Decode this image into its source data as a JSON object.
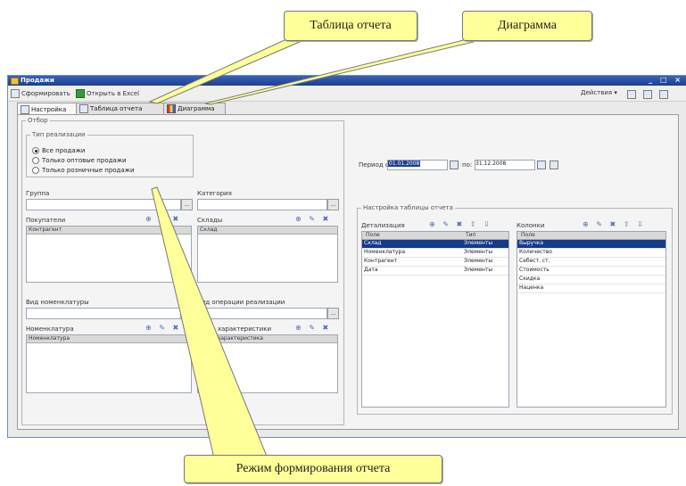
{
  "callouts": {
    "table": "Таблица отчета",
    "chart": "Диаграмма",
    "mode": "Режим формирования отчета"
  },
  "window": {
    "title": "Продажи",
    "controls": "_ □ ×"
  },
  "toolbar": {
    "generate": "Сформировать",
    "excel": "Открыть в Excel",
    "actions": "Действия ▾"
  },
  "tabs": [
    {
      "label": "Настройка"
    },
    {
      "label": "Таблица отчета"
    },
    {
      "label": "Диаграмма"
    }
  ],
  "filters": {
    "legend": "Отбор",
    "sales_type": {
      "legend": "Тип реализации",
      "options": [
        "Все продажи",
        "Только оптовые продажи",
        "Только розничные продажи"
      ]
    },
    "group_label": "Группа",
    "category_label": "Категория",
    "buyers_label": "Покупатели",
    "buyers_col": "Контрагент",
    "stores_label": "Склады",
    "stores_col": "Склад",
    "nom_type_label": "Вид номенклатуры",
    "sale_type_label": "Вид операции реализации",
    "nomenclature_label": "Номенклатура",
    "nomenclature_col": "Номенклатура",
    "special_label": "Спец. характеристики",
    "special_col": "Спец. характеристика"
  },
  "period": {
    "from_label": "Период с:",
    "from_value": "01.01.2008",
    "to_label": "по:",
    "to_value": "31.12.2008"
  },
  "report_settings": {
    "legend": "Настройка таблицы отчета",
    "dims_label": "Детализация",
    "dims_col1": "Поле",
    "dims_col2": "Тип",
    "dims": [
      {
        "field": "Склад",
        "type": "Элементы"
      },
      {
        "field": "Номенклатура",
        "type": "Элементы"
      },
      {
        "field": "Контрагент",
        "type": "Элементы"
      },
      {
        "field": "Дата",
        "type": "Элементы"
      }
    ],
    "measures_label": "Колонки",
    "measures_col": "Поле",
    "measures": [
      "Выручка",
      "Количество",
      "Себест. ст.",
      "Стоимость",
      "Скидка",
      "Наценка"
    ]
  },
  "icons": {
    "filter_tools": "⊕ ✎ ✖",
    "order_tools": "⊕ ✎ ✖ ⇧ ⇩"
  }
}
